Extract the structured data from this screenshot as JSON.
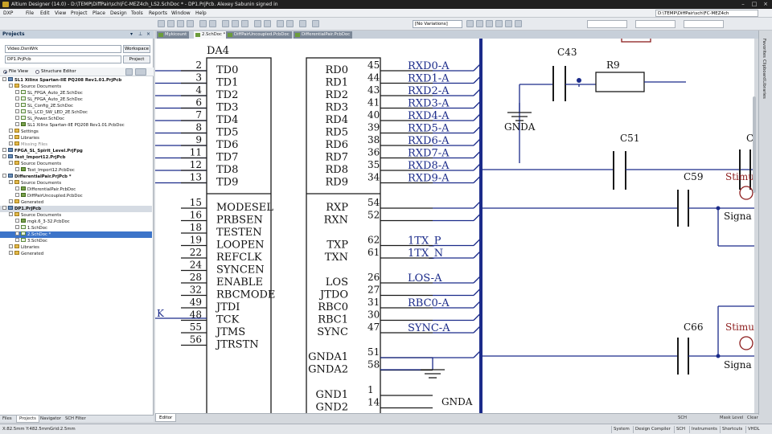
{
  "app": {
    "title": "Altium Designer (14.0) - D:\\TEMP\\DiffPair\\sch\\FC-MEZ4ch_LS2.SchDoc * - DP1.PrjPcb. Alexey Sabunin signed in",
    "path": "D:\\TEMP\\DiffPair\\sch\\FC-MEZ4ch"
  },
  "menu": [
    "DXP",
    "File",
    "Edit",
    "View",
    "Project",
    "Place",
    "Design",
    "Tools",
    "Reports",
    "Window",
    "Help"
  ],
  "toolbar": {
    "variations": "[No Variations]"
  },
  "projects_panel": {
    "title": "Projects",
    "workspace_value": "Video.DsnWrk",
    "workspace_button": "Workspace",
    "project_value": "DP1.PrjPcb",
    "project_button": "Project",
    "view_file": "File View",
    "view_structure": "Structure Editor",
    "tree": [
      {
        "label": "SL1 Xilinx Spartan-IIE PQ208 Rev1.01.PrjPcb",
        "level": 0,
        "icon": "proj",
        "bold": true
      },
      {
        "label": "Source Documents",
        "level": 1,
        "icon": "folder"
      },
      {
        "label": "SL_FPGA_Auto_2E.SchDoc",
        "level": 2,
        "icon": "doc"
      },
      {
        "label": "SL_FPGA_Auto_2E.SchDoc",
        "level": 2,
        "icon": "doc"
      },
      {
        "label": "SL_Config_2E.SchDoc",
        "level": 2,
        "icon": "doc"
      },
      {
        "label": "SL_LCD_SW_LED_2E.SchDoc",
        "level": 2,
        "icon": "doc"
      },
      {
        "label": "SL_Power.SchDoc",
        "level": 2,
        "icon": "doc"
      },
      {
        "label": "SL1 Xilinx Spartan-IIE PQ208 Rev1.01.PcbDoc",
        "level": 2,
        "icon": "pcb"
      },
      {
        "label": "Settings",
        "level": 1,
        "icon": "folder"
      },
      {
        "label": "Libraries",
        "level": 1,
        "icon": "folder"
      },
      {
        "label": "Missing Files",
        "level": 1,
        "icon": "folder",
        "grey": true
      },
      {
        "label": "FPGA_SL_Spirit_Level.PrjFpg",
        "level": 0,
        "icon": "proj",
        "bold": true
      },
      {
        "label": "Test_Import12.PrjPcb",
        "level": 0,
        "icon": "proj",
        "bold": true
      },
      {
        "label": "Source Documents",
        "level": 1,
        "icon": "folder"
      },
      {
        "label": "Test_Import12.PcbDoc",
        "level": 2,
        "icon": "pcb"
      },
      {
        "label": "DifferentialPair.PrjPcb *",
        "level": 0,
        "icon": "proj",
        "bold": true
      },
      {
        "label": "Source Documents",
        "level": 1,
        "icon": "folder"
      },
      {
        "label": "DifferentialPair.PcbDoc",
        "level": 2,
        "icon": "pcb"
      },
      {
        "label": "DiffPairUncoupled.PcbDoc",
        "level": 2,
        "icon": "pcb"
      },
      {
        "label": "Generated",
        "level": 1,
        "icon": "folder"
      },
      {
        "label": "DP1.PrjPcb",
        "level": 0,
        "icon": "proj",
        "bold": true,
        "hl": true
      },
      {
        "label": "Source Documents",
        "level": 1,
        "icon": "folder"
      },
      {
        "label": "mgk.6_3-32.PcbDoc",
        "level": 2,
        "icon": "pcb"
      },
      {
        "label": "1.SchDoc",
        "level": 2,
        "icon": "doc"
      },
      {
        "label": "2.SchDoc *",
        "level": 2,
        "icon": "doc",
        "sel": true
      },
      {
        "label": "3.SchDoc",
        "level": 2,
        "icon": "doc"
      },
      {
        "label": "Libraries",
        "level": 1,
        "icon": "folder"
      },
      {
        "label": "Generated",
        "level": 1,
        "icon": "folder"
      }
    ],
    "tabs": [
      "Files",
      "Projects",
      "Navigator",
      "SCH Filter"
    ]
  },
  "doc_tabs": [
    "Mykicount",
    "2.SchDoc *",
    "DiffPairUncoupled.PcbDoc",
    "DifferentialPair.PcbDoc"
  ],
  "right_panel": [
    "Favorites",
    "Clipboard",
    "Libraries"
  ],
  "schematic": {
    "designator": "DA4",
    "left_pins": [
      {
        "num": "2",
        "name": "TD0"
      },
      {
        "num": "3",
        "name": "TD1"
      },
      {
        "num": "4",
        "name": "TD2"
      },
      {
        "num": "6",
        "name": "TD3"
      },
      {
        "num": "7",
        "name": "TD4"
      },
      {
        "num": "8",
        "name": "TD5"
      },
      {
        "num": "9",
        "name": "TD6"
      },
      {
        "num": "11",
        "name": "TD7"
      },
      {
        "num": "12",
        "name": "TD8"
      },
      {
        "num": "13",
        "name": "TD9"
      },
      {
        "num": "15",
        "name": "MODESEL"
      },
      {
        "num": "16",
        "name": "PRBSEN"
      },
      {
        "num": "18",
        "name": "TESTEN"
      },
      {
        "num": "19",
        "name": "LOOPEN"
      },
      {
        "num": "22",
        "name": "REFCLK"
      },
      {
        "num": "24",
        "name": "SYNCEN"
      },
      {
        "num": "28",
        "name": "ENABLE"
      },
      {
        "num": "32",
        "name": "RBCMODE"
      },
      {
        "num": "49",
        "name": "JTDI"
      },
      {
        "num": "48",
        "name": "TCK"
      },
      {
        "num": "55",
        "name": "JTMS"
      },
      {
        "num": "56",
        "name": "JTRSTN"
      }
    ],
    "right_pins": [
      {
        "num": "45",
        "name": "RD0",
        "net": "RXD0-A"
      },
      {
        "num": "44",
        "name": "RD1",
        "net": "RXD1-A"
      },
      {
        "num": "43",
        "name": "RD2",
        "net": "RXD2-A"
      },
      {
        "num": "41",
        "name": "RD3",
        "net": "RXD3-A"
      },
      {
        "num": "40",
        "name": "RD4",
        "net": "RXD4-A"
      },
      {
        "num": "39",
        "name": "RD5",
        "net": "RXD5-A"
      },
      {
        "num": "38",
        "name": "RD6",
        "net": "RXD6-A"
      },
      {
        "num": "36",
        "name": "RD7",
        "net": "RXD7-A"
      },
      {
        "num": "35",
        "name": "RD8",
        "net": "RXD8-A"
      },
      {
        "num": "34",
        "name": "RD9",
        "net": "RXD9-A"
      },
      {
        "num": "54",
        "name": "RXP",
        "net": ""
      },
      {
        "num": "52",
        "name": "RXN",
        "net": ""
      },
      {
        "num": "62",
        "name": "TXP",
        "net": "1TX_P"
      },
      {
        "num": "61",
        "name": "TXN",
        "net": "1TX_N"
      },
      {
        "num": "26",
        "name": "LOS",
        "net": "LOS-A"
      },
      {
        "num": "27",
        "name": "JTDO",
        "net": ""
      },
      {
        "num": "31",
        "name": "RBC0",
        "net": "RBC0-A"
      },
      {
        "num": "30",
        "name": "RBC1",
        "net": ""
      },
      {
        "num": "47",
        "name": "SYNC",
        "net": "SYNC-A"
      },
      {
        "num": "51",
        "name": "GNDA1",
        "net": ""
      },
      {
        "num": "58",
        "name": "GNDA2",
        "net": ""
      },
      {
        "num": "1",
        "name": "GND1",
        "net": ""
      },
      {
        "num": "14",
        "name": "GND2",
        "net": ""
      }
    ],
    "components": {
      "c43": "C43",
      "r9": "R9",
      "c51": "C51",
      "c59": "C59",
      "c66": "C66",
      "c_partial": "C",
      "gnda_top": "GNDA",
      "gnda_bottom": "GNDA",
      "stim1": "Stimu",
      "stim2": "Stimu",
      "sig1": "Signa",
      "sig2": "Signa",
      "wk": "K"
    }
  },
  "editor_tab": "Editor",
  "editor_right": [
    "SCH",
    "Mask Level",
    "Clear"
  ],
  "statusbar": {
    "coords": "X:82.5mm Y:482.5mm",
    "grid": "Grid:2.5mm",
    "buttons": [
      "System",
      "Design Compiler",
      "SCH",
      "Instruments",
      "Shortcuts",
      "VHDL"
    ]
  }
}
